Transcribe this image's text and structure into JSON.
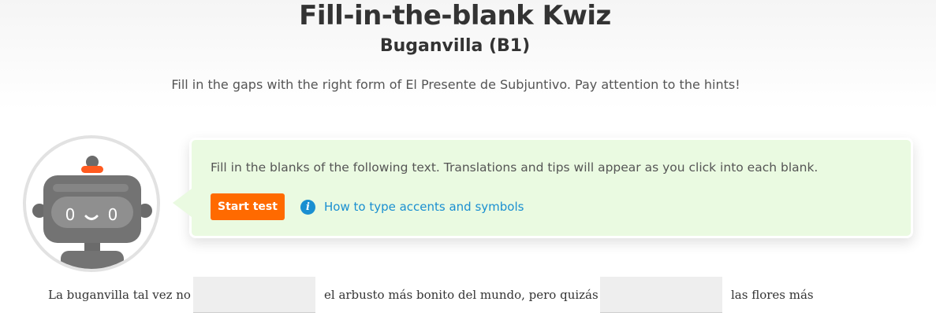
{
  "header": {
    "title": "Fill-in-the-blank Kwiz",
    "subtitle": "Buganvilla (B1)",
    "instructions": "Fill in the gaps with the right form of El Presente de Subjuntivo. Pay attention to the hints!"
  },
  "mascot": {
    "icon": "robot-icon",
    "accent_color": "#ff5a1f"
  },
  "bubble": {
    "text": "Fill in the blanks of the following text. Translations and tips will appear as you click into each blank.",
    "start_button_label": "Start test",
    "help_link_label": "How to type accents and symbols",
    "info_icon_glyph": "i"
  },
  "sentence": {
    "segment_1": "La buganvilla tal vez no",
    "segment_2": "el arbusto más bonito del mundo,  pero quizás",
    "segment_3": "las flores más",
    "blank_1_value": "",
    "blank_2_value": ""
  },
  "colors": {
    "accent_orange": "#ff6a00",
    "bubble_green": "#eafae1",
    "link_blue": "#1a8fd1"
  }
}
